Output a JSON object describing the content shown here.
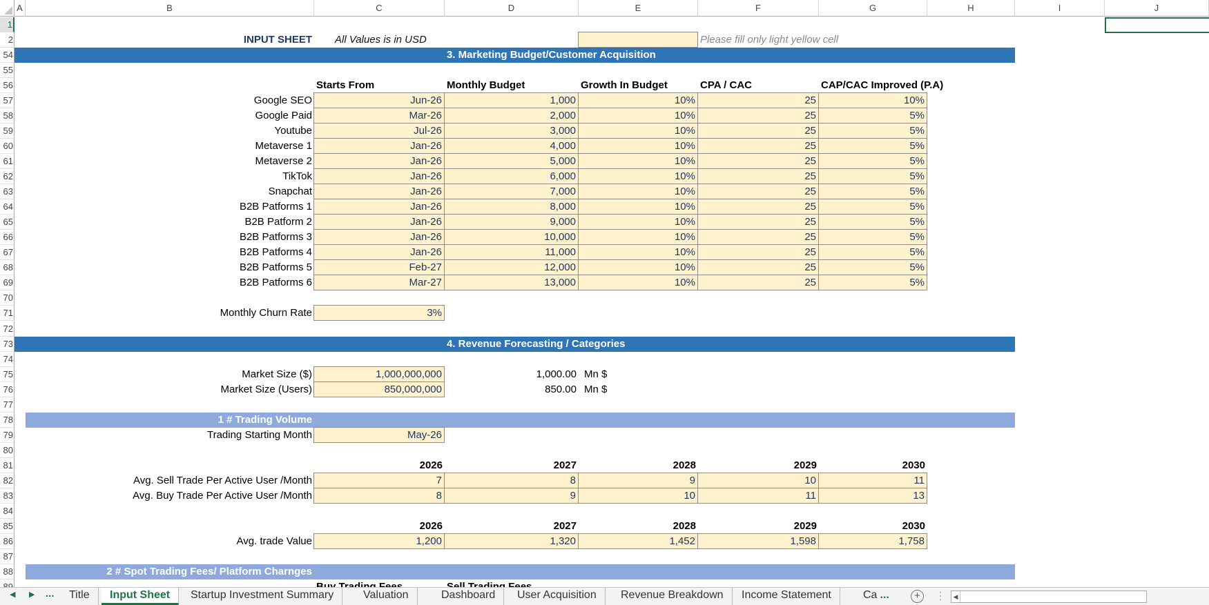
{
  "colors": {
    "band": "#2e75b6",
    "subband": "#8ea9db",
    "input_fill": "#fff2cc",
    "active_tab": "#217346"
  },
  "columns": [
    "A",
    "B",
    "C",
    "D",
    "E",
    "F",
    "G",
    "H",
    "I",
    "J"
  ],
  "selected_cell": "J1",
  "rows": [
    {
      "num": "1",
      "cells": []
    },
    {
      "num": "2",
      "cells": [
        {
          "col": "B",
          "kind": "title",
          "text": "INPUT SHEET"
        },
        {
          "col": "C",
          "kind": "note",
          "text": "All Values is in USD"
        },
        {
          "col": "E",
          "kind": "input",
          "text": ""
        },
        {
          "col": "F",
          "kind": "hint",
          "text": "Please fill only light yellow cell"
        }
      ]
    },
    {
      "num": "54",
      "cells": [
        {
          "col": "A",
          "span": "H",
          "kind": "band",
          "text": "3. Marketing Budget/Customer Acquisition"
        }
      ]
    },
    {
      "num": "55",
      "cells": []
    },
    {
      "num": "56",
      "cells": [
        {
          "col": "C",
          "kind": "header first",
          "text": "Starts From"
        },
        {
          "col": "D",
          "kind": "header",
          "text": "Monthly Budget"
        },
        {
          "col": "E",
          "kind": "header",
          "text": "Growth In Budget"
        },
        {
          "col": "F",
          "kind": "header",
          "text": "CPA / CAC"
        },
        {
          "col": "G",
          "kind": "header",
          "text": "CAP/CAC Improved (P.A)"
        }
      ]
    },
    {
      "num": "57",
      "channel": [
        "Google SEO",
        "Jun-26",
        "1,000",
        "10%",
        "25",
        "10%"
      ]
    },
    {
      "num": "58",
      "channel": [
        "Google Paid",
        "Mar-26",
        "2,000",
        "10%",
        "25",
        "5%"
      ]
    },
    {
      "num": "59",
      "channel": [
        "Youtube",
        "Jul-26",
        "3,000",
        "10%",
        "25",
        "5%"
      ]
    },
    {
      "num": "60",
      "channel": [
        "Metaverse 1",
        "Jan-26",
        "4,000",
        "10%",
        "25",
        "5%"
      ]
    },
    {
      "num": "61",
      "channel": [
        "Metaverse 2",
        "Jan-26",
        "5,000",
        "10%",
        "25",
        "5%"
      ]
    },
    {
      "num": "62",
      "channel": [
        "TikTok",
        "Jan-26",
        "6,000",
        "10%",
        "25",
        "5%"
      ]
    },
    {
      "num": "63",
      "channel": [
        "Snapchat",
        "Jan-26",
        "7,000",
        "10%",
        "25",
        "5%"
      ]
    },
    {
      "num": "64",
      "channel": [
        "B2B Patforms 1",
        "Jan-26",
        "8,000",
        "10%",
        "25",
        "5%"
      ]
    },
    {
      "num": "65",
      "channel": [
        "B2B Patform 2",
        "Jan-26",
        "9,000",
        "10%",
        "25",
        "5%"
      ]
    },
    {
      "num": "66",
      "channel": [
        "B2B Patforms 3",
        "Jan-26",
        "10,000",
        "10%",
        "25",
        "5%"
      ]
    },
    {
      "num": "67",
      "channel": [
        "B2B Patforms 4",
        "Jan-26",
        "11,000",
        "10%",
        "25",
        "5%"
      ]
    },
    {
      "num": "68",
      "channel": [
        "B2B Patforms 5",
        "Feb-27",
        "12,000",
        "10%",
        "25",
        "5%"
      ]
    },
    {
      "num": "69",
      "channel": [
        "B2B Patforms 6",
        "Mar-27",
        "13,000",
        "10%",
        "25",
        "5%"
      ]
    },
    {
      "num": "70",
      "cells": []
    },
    {
      "num": "71",
      "cells": [
        {
          "col": "B",
          "kind": "label",
          "text": "Monthly Churn Rate"
        },
        {
          "col": "C",
          "kind": "input",
          "text": "3%"
        }
      ]
    },
    {
      "num": "72",
      "cells": []
    },
    {
      "num": "73",
      "cells": [
        {
          "col": "A",
          "span": "H",
          "kind": "band",
          "text": "4. Revenue Forecasting / Categories"
        }
      ]
    },
    {
      "num": "74",
      "cells": []
    },
    {
      "num": "75",
      "cells": [
        {
          "col": "B",
          "kind": "label",
          "text": "Market Size ($)"
        },
        {
          "col": "C",
          "kind": "input",
          "text": "1,000,000,000"
        },
        {
          "col": "D",
          "kind": "value",
          "text": "1,000.00"
        },
        {
          "col": "E",
          "kind": "unit",
          "text": "Mn $"
        }
      ]
    },
    {
      "num": "76",
      "cells": [
        {
          "col": "B",
          "kind": "label",
          "text": "Market Size (Users)"
        },
        {
          "col": "C",
          "kind": "input",
          "text": "850,000,000"
        },
        {
          "col": "D",
          "kind": "value",
          "text": "850.00"
        },
        {
          "col": "E",
          "kind": "unit",
          "text": "Mn $"
        }
      ]
    },
    {
      "num": "77",
      "cells": []
    },
    {
      "num": "78",
      "cells": [
        {
          "col": "B",
          "span": "H",
          "kind": "subband",
          "text": "1 # Trading Volume"
        }
      ]
    },
    {
      "num": "79",
      "cells": [
        {
          "col": "B",
          "kind": "label",
          "text": "Trading Starting Month"
        },
        {
          "col": "C",
          "kind": "input",
          "text": "May-26"
        }
      ]
    },
    {
      "num": "80",
      "cells": []
    },
    {
      "num": "81",
      "cells": [
        {
          "col": "C",
          "kind": "year",
          "text": "2026"
        },
        {
          "col": "D",
          "kind": "year",
          "text": "2027"
        },
        {
          "col": "E",
          "kind": "year",
          "text": "2028"
        },
        {
          "col": "F",
          "kind": "year",
          "text": "2029"
        },
        {
          "col": "G",
          "kind": "year",
          "text": "2030"
        }
      ]
    },
    {
      "num": "82",
      "cells": [
        {
          "col": "B",
          "kind": "label",
          "text": "Avg. Sell Trade Per Active User /Month"
        },
        {
          "col": "C",
          "kind": "input",
          "text": "7"
        },
        {
          "col": "D",
          "kind": "input",
          "text": "8"
        },
        {
          "col": "E",
          "kind": "input",
          "text": "9"
        },
        {
          "col": "F",
          "kind": "input",
          "text": "10"
        },
        {
          "col": "G",
          "kind": "input",
          "text": "11"
        }
      ]
    },
    {
      "num": "83",
      "cells": [
        {
          "col": "B",
          "kind": "label",
          "text": "Avg. Buy Trade Per Active User /Month"
        },
        {
          "col": "C",
          "kind": "input",
          "text": "8"
        },
        {
          "col": "D",
          "kind": "input",
          "text": "9"
        },
        {
          "col": "E",
          "kind": "input",
          "text": "10"
        },
        {
          "col": "F",
          "kind": "input",
          "text": "11"
        },
        {
          "col": "G",
          "kind": "input",
          "text": "13"
        }
      ]
    },
    {
      "num": "84",
      "cells": []
    },
    {
      "num": "85",
      "cells": [
        {
          "col": "C",
          "kind": "year",
          "text": "2026"
        },
        {
          "col": "D",
          "kind": "year",
          "text": "2027"
        },
        {
          "col": "E",
          "kind": "year",
          "text": "2028"
        },
        {
          "col": "F",
          "kind": "year",
          "text": "2029"
        },
        {
          "col": "G",
          "kind": "year",
          "text": "2030"
        }
      ]
    },
    {
      "num": "86",
      "cells": [
        {
          "col": "B",
          "kind": "label",
          "text": "Avg. trade Value"
        },
        {
          "col": "C",
          "kind": "input",
          "text": "1,200"
        },
        {
          "col": "D",
          "kind": "input",
          "text": "1,320"
        },
        {
          "col": "E",
          "kind": "input",
          "text": "1,452"
        },
        {
          "col": "F",
          "kind": "input",
          "text": "1,598"
        },
        {
          "col": "G",
          "kind": "input",
          "text": "1,758"
        }
      ]
    },
    {
      "num": "87",
      "cells": []
    },
    {
      "num": "88",
      "cells": [
        {
          "col": "B",
          "span": "H",
          "kind": "subband",
          "text": "2 # Spot Trading Fees/ Platform Charnges"
        }
      ]
    },
    {
      "num": "89",
      "cells": [
        {
          "col": "C",
          "kind": "header clip",
          "text": "Buy Trading Fees"
        },
        {
          "col": "D",
          "kind": "header clip",
          "text": "Sell Trading Fees"
        }
      ]
    }
  ],
  "tabbar": {
    "more": "...",
    "tabs": [
      {
        "label": "Title"
      },
      {
        "label": "Input Sheet",
        "active": true
      },
      {
        "label": "Startup Investment Summary"
      },
      {
        "label": "Valuation"
      },
      {
        "label": "Dashboard"
      },
      {
        "label": "User Acquisition"
      },
      {
        "label": "Revenue Breakdown"
      },
      {
        "label": "Income Statement"
      },
      {
        "label": "Ca"
      }
    ],
    "overflow": "...",
    "add": "+"
  }
}
